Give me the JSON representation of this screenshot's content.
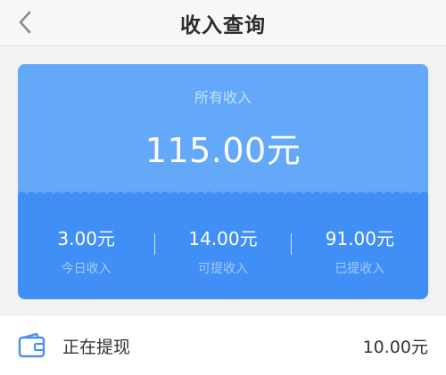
{
  "navbar": {
    "title": "收入查询",
    "back_icon": "chevron-left-icon"
  },
  "summary": {
    "label": "所有收入",
    "total": "115.00元",
    "stats": [
      {
        "value": "3.00元",
        "label": "今日收入"
      },
      {
        "value": "14.00元",
        "label": "可提收入"
      },
      {
        "value": "91.00元",
        "label": "已提收入"
      }
    ]
  },
  "withdrawal": {
    "icon": "wallet-icon",
    "label": "正在提现",
    "value": "10.00元"
  },
  "colors": {
    "card_top": "#63a8f9",
    "card_bottom": "#3f8ff6",
    "background": "#f2f2f4"
  }
}
